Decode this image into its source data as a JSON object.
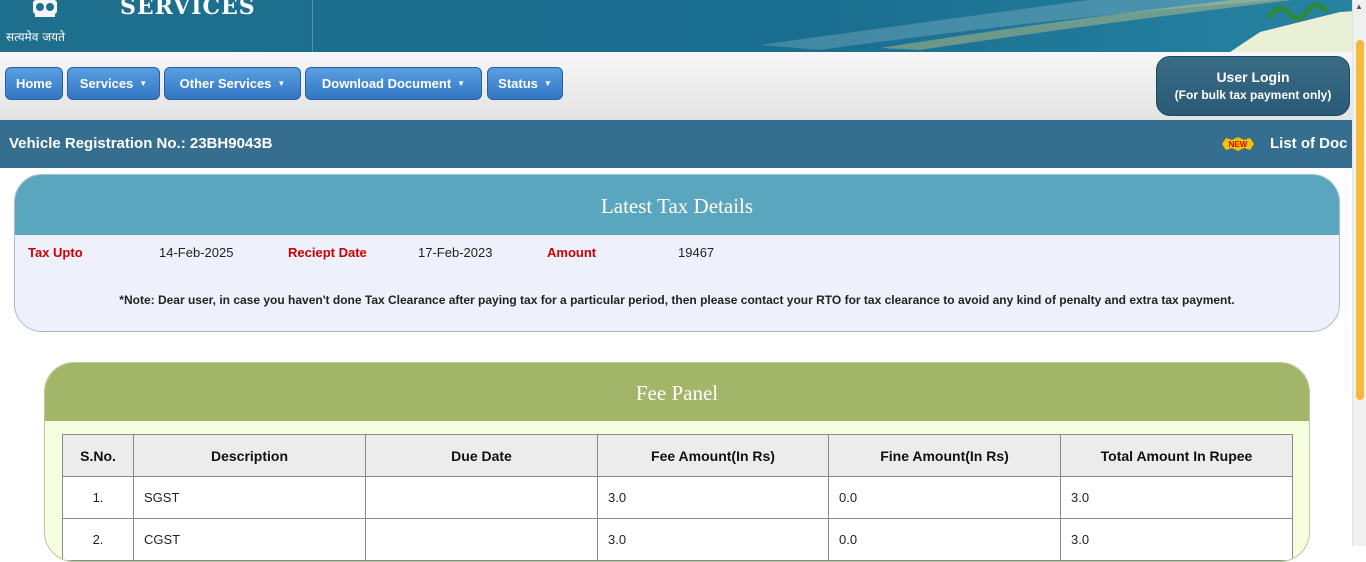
{
  "header": {
    "brand": "SERVICES",
    "motto": "सत्यमेव जयते"
  },
  "nav": {
    "home": "Home",
    "services": "Services",
    "other_services": "Other Services",
    "download_document": "Download Document",
    "status": "Status",
    "caret": "▼",
    "login_title": "User Login",
    "login_subtitle": "(For bulk tax payment only)"
  },
  "vehicle": {
    "label": "Vehicle Registration No.: 23BH9043B",
    "new_tag": "NEW",
    "documents_link": "List of Doc"
  },
  "tax": {
    "title": "Latest Tax Details",
    "tax_upto_label": "Tax Upto",
    "tax_upto_value": "14-Feb-2025",
    "receipt_date_label": "Reciept Date",
    "receipt_date_value": "17-Feb-2023",
    "amount_label": "Amount",
    "amount_value": "19467",
    "note": "*Note: Dear user, in case you haven't done Tax Clearance after paying tax for a particular period, then please contact your RTO for tax clearance to avoid any kind of penalty and extra tax payment."
  },
  "fee": {
    "title": "Fee Panel",
    "columns": [
      "S.No.",
      "Description",
      "Due Date",
      "Fee Amount(In Rs)",
      "Fine Amount(In Rs)",
      "Total Amount In Rupee"
    ],
    "rows": [
      {
        "sno": "1.",
        "description": "SGST",
        "due_date": "",
        "fee": "3.0",
        "fine": "0.0",
        "total": "3.0"
      },
      {
        "sno": "2.",
        "description": "CGST",
        "due_date": "",
        "fee": "3.0",
        "fine": "0.0",
        "total": "3.0"
      }
    ]
  },
  "colors": {
    "header_bg": "#1e6f8e",
    "nav_button": "#3276c4",
    "vehicle_bar": "#356e8f",
    "tax_header": "#5ba6bf",
    "fee_header": "#a2b568",
    "label_red": "#cc0000",
    "scroll_thumb": "#f5b93e"
  }
}
